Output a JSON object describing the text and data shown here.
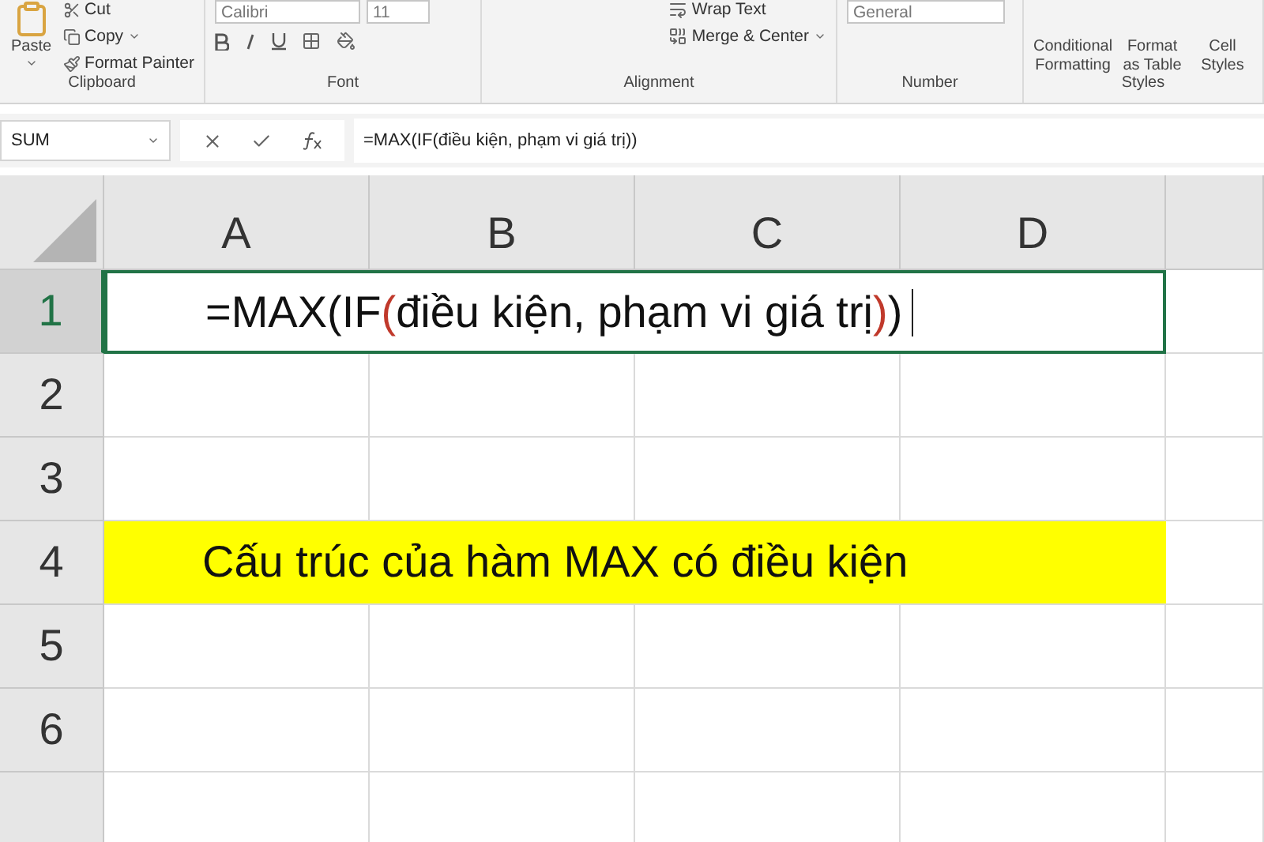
{
  "clipboard": {
    "paste": "Paste",
    "cut": "Cut",
    "copy": "Copy",
    "format_painter": "Format Painter",
    "label": "Clipboard"
  },
  "font": {
    "name": "Calibri",
    "size": "11",
    "label": "Font"
  },
  "alignment": {
    "wrap": "Wrap Text",
    "merge": "Merge & Center",
    "label": "Alignment"
  },
  "number": {
    "format": "General",
    "label": "Number"
  },
  "styles": {
    "items": [
      "Conditional Formatting",
      "Format as Table",
      "Cell Styles"
    ],
    "label": "Styles"
  },
  "formula_bar": {
    "name_box": "SUM",
    "formula": "=MAX(IF(điều kiện, phạm vi giá trị))"
  },
  "columns": [
    {
      "label": "A",
      "selected": false
    },
    {
      "label": "B",
      "selected": false
    },
    {
      "label": "C",
      "selected": false
    },
    {
      "label": "D",
      "selected": false
    }
  ],
  "rows": [
    {
      "label": "1",
      "selected": true,
      "kind": "formula",
      "segments": [
        {
          "text": "=MAX(IF",
          "highlight": false
        },
        {
          "text": "(",
          "highlight": true
        },
        {
          "text": "điều kiện, phạm vi giá trị",
          "highlight": false
        },
        {
          "text": ")",
          "highlight": true
        },
        {
          "text": ")",
          "highlight": false
        }
      ]
    },
    {
      "label": "2",
      "selected": false,
      "kind": "empty"
    },
    {
      "label": "3",
      "selected": false,
      "kind": "empty"
    },
    {
      "label": "4",
      "selected": false,
      "kind": "banner",
      "text": "Cấu trúc của hàm MAX có điều kiện",
      "color": "#ffff00"
    },
    {
      "label": "5",
      "selected": false,
      "kind": "empty"
    },
    {
      "label": "6",
      "selected": false,
      "kind": "empty"
    }
  ]
}
